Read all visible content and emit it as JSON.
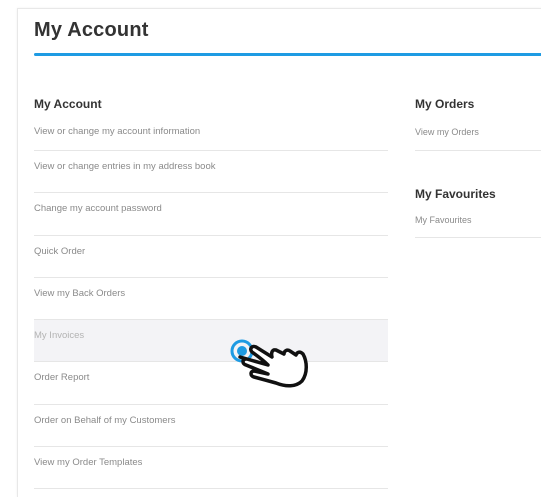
{
  "page": {
    "title": "My Account"
  },
  "account_section": {
    "heading": "My Account",
    "links": [
      {
        "label": "View or change my account information"
      },
      {
        "label": "View or change entries in my address book"
      },
      {
        "label": "Change my account password"
      },
      {
        "label": "Quick Order"
      },
      {
        "label": "View my Back Orders"
      },
      {
        "label": "My Invoices"
      },
      {
        "label": "Order Report"
      },
      {
        "label": "Order on Behalf of my Customers"
      },
      {
        "label": "View my Order Templates"
      }
    ]
  },
  "orders_section": {
    "heading": "My Orders",
    "link": "View my Orders"
  },
  "favourites_section": {
    "heading": "My Favourites",
    "link": "My Favourites"
  },
  "colors": {
    "accent": "#1e9be3",
    "heading": "#333333",
    "link": "#8a8a8a",
    "hover_bg": "#f3f3f6"
  },
  "icons": {
    "cursor": "hand-pointer-icon"
  }
}
